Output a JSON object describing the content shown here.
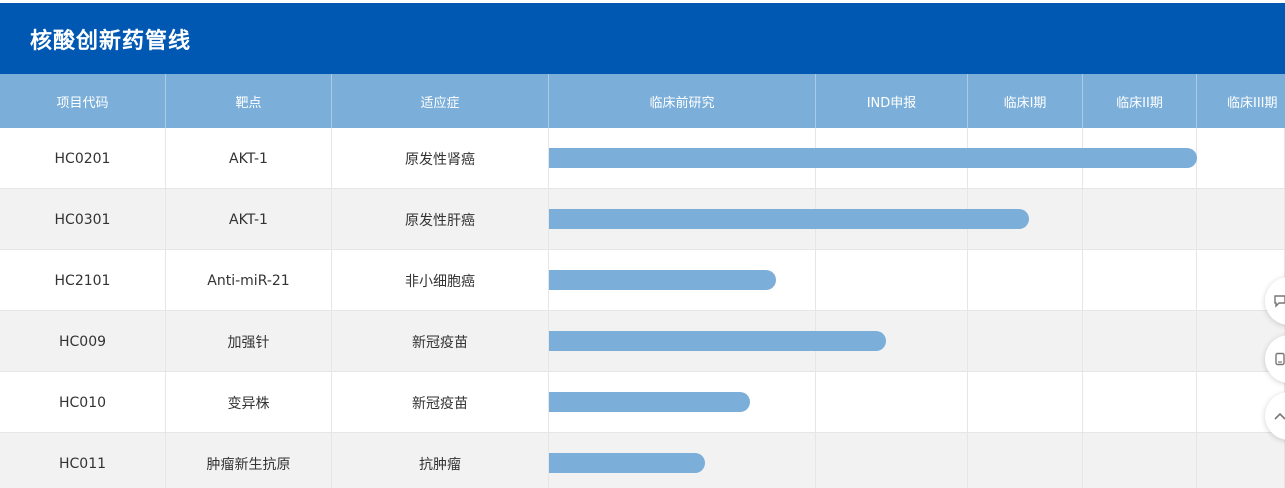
{
  "title": "核酸创新药管线",
  "columns": [
    "项目代码",
    "靶点",
    "适应症",
    "临床前研究",
    "IND申报",
    "临床I期",
    "临床II期",
    "临床III期"
  ],
  "rows": [
    {
      "code": "HC0201",
      "target": "AKT-1",
      "indication": "原发性肾癌",
      "progress": 1.0
    },
    {
      "code": "HC0301",
      "target": "AKT-1",
      "indication": "原发性肝癌",
      "progress": 0.74
    },
    {
      "code": "HC2101",
      "target": "Anti-miR-21",
      "indication": "非小细胞癌",
      "progress": 0.35
    },
    {
      "code": "HC009",
      "target": "加强针",
      "indication": "新冠疫苗",
      "progress": 0.52
    },
    {
      "code": "HC010",
      "target": "变异株",
      "indication": "新冠疫苗",
      "progress": 0.31
    },
    {
      "code": "HC011",
      "target": "肿瘤新生抗原",
      "indication": "抗肿瘤",
      "progress": 0.24
    }
  ],
  "colors": {
    "header_bg": "#0058b3",
    "column_header_bg": "#7bafd9",
    "bar": "#7bafd9",
    "alt_row": "#f2f2f2"
  },
  "floating_icons": [
    "chat-icon",
    "phone-icon",
    "back-to-top-icon"
  ]
}
